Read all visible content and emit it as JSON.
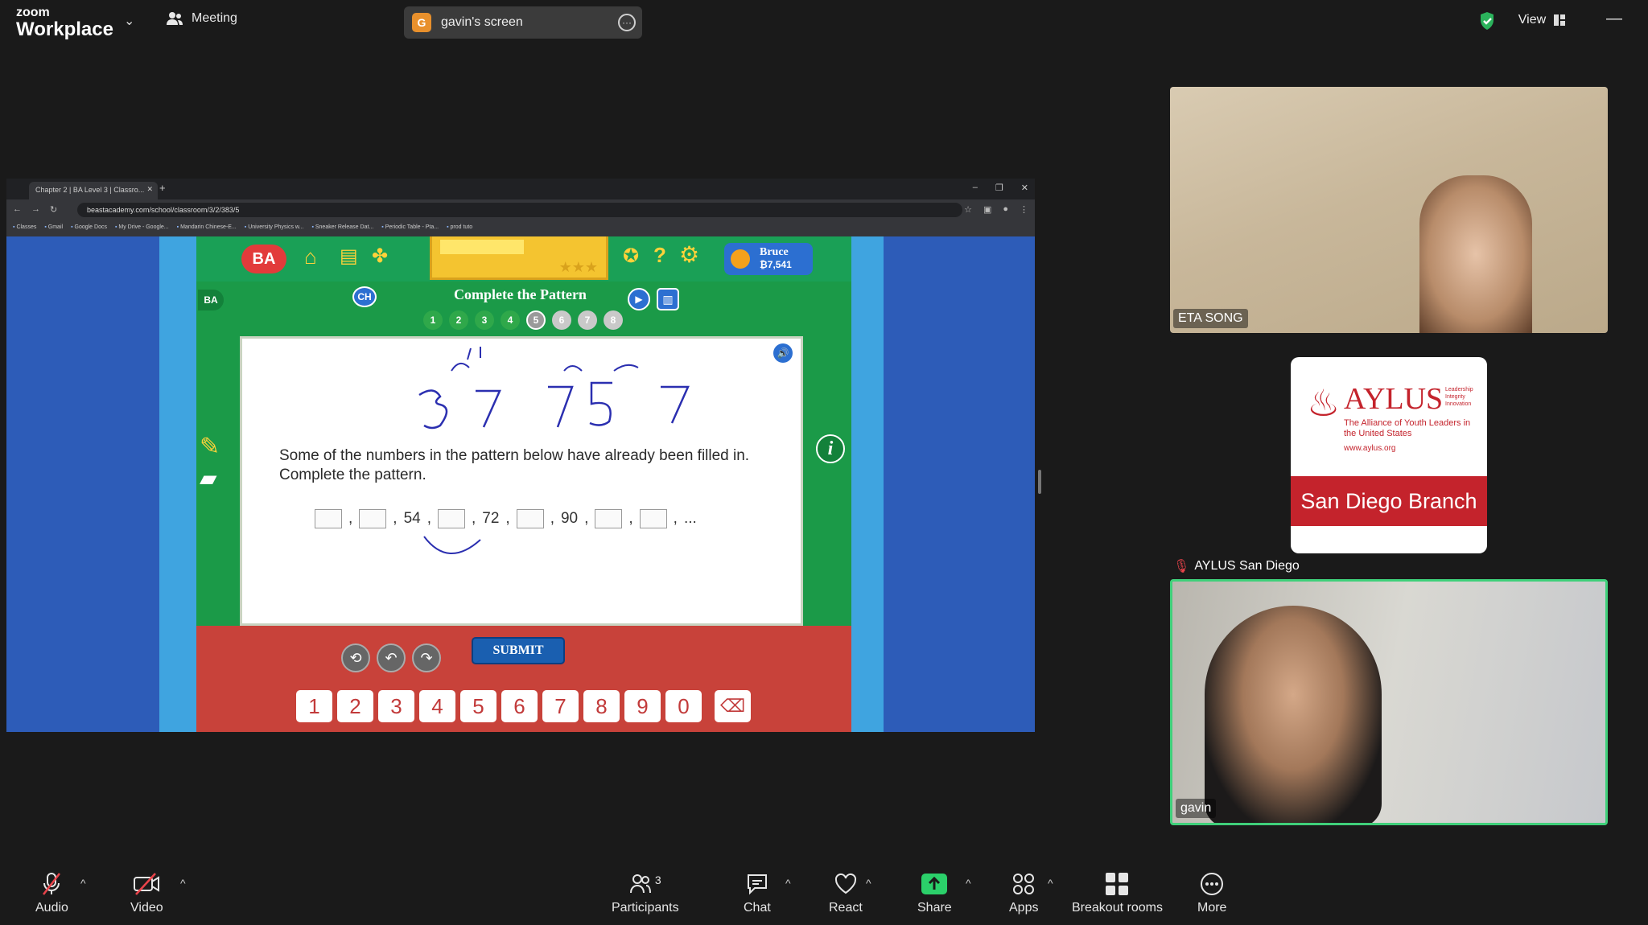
{
  "topbar": {
    "logo_line1": "zoom",
    "logo_line2": "Workplace",
    "meeting_label": "Meeting",
    "screen_badge": "G",
    "screen_label": "gavin's screen",
    "view_label": "View"
  },
  "browser": {
    "tab_title": "Chapter 2 | BA Level 3 | Classro...",
    "url": "beastacademy.com/school/classroom/3/2/383/5",
    "bookmarks": [
      "Classes",
      "Gmail",
      "Google Docs",
      "My Drive - Google...",
      "Mandarin Chinese-E...",
      "University Physics w...",
      "Sneaker Release Dat...",
      "Periodic Table - Pta...",
      "prod tuto"
    ]
  },
  "game": {
    "logo": "BA",
    "chapter_badge": "CH",
    "user_name": "Bruce",
    "user_coins": "₿7,541",
    "title": "Complete the Pattern",
    "problem_dots": [
      "1",
      "2",
      "3",
      "4",
      "5",
      "6",
      "7",
      "8"
    ],
    "question": "Some of the numbers in the pattern below have already been filled in. Complete the pattern.",
    "pattern_values": [
      "",
      "",
      "54",
      "",
      "72",
      "",
      "90",
      "",
      ""
    ],
    "pattern_ellipsis": "...",
    "handwriting": "3, 7  7, 5  7",
    "submit_label": "SUBMIT",
    "keypad": [
      "1",
      "2",
      "3",
      "4",
      "5",
      "6",
      "7",
      "8",
      "9",
      "0"
    ],
    "info_label": "i"
  },
  "participants": [
    {
      "name": "ETA SONG"
    },
    {
      "name": "AYLUS San Diego"
    },
    {
      "name": "gavin"
    }
  ],
  "aylus_card": {
    "title": "AYLUS",
    "tagline": "Leadership Integrity Innovation",
    "subtitle": "The Alliance of Youth Leaders in the United States",
    "url": "www.aylus.org",
    "branch": "San Diego Branch"
  },
  "toolbar": {
    "audio": "Audio",
    "video": "Video",
    "participants": "Participants",
    "participants_count": "3",
    "chat": "Chat",
    "react": "React",
    "share": "Share",
    "apps": "Apps",
    "breakout": "Breakout rooms",
    "more": "More"
  },
  "colors": {
    "accent_green": "#22a86a",
    "game_blue": "#2d5cb8",
    "speaker_border": "#3fd07a"
  }
}
